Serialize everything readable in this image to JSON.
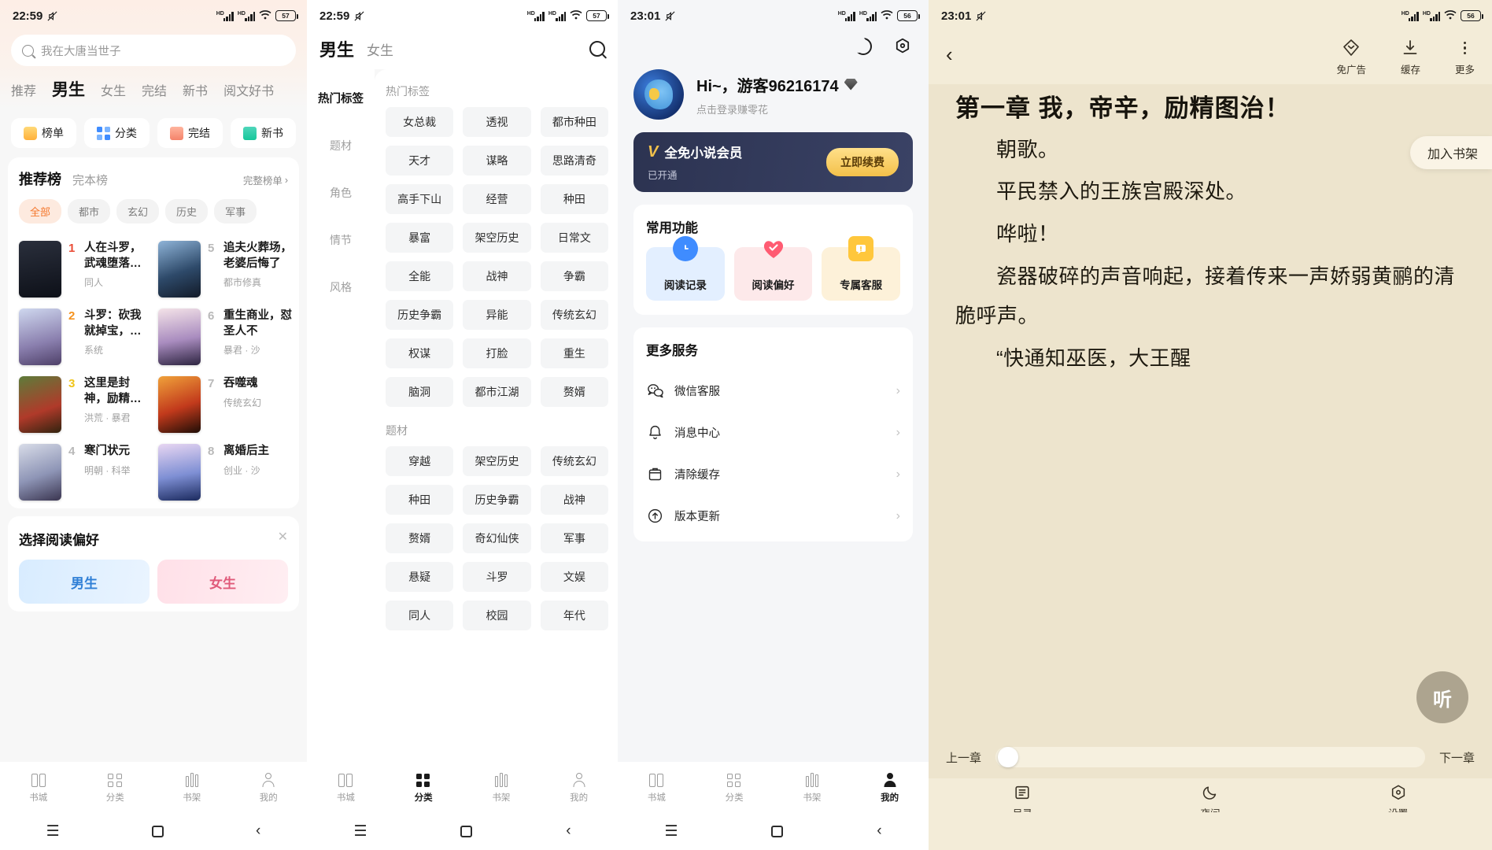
{
  "panel1": {
    "status": {
      "time": "22:59",
      "battery": "57"
    },
    "search": {
      "placeholder": "我在大唐当世子",
      "icon": "search-icon"
    },
    "tabs": [
      {
        "label": "推荐",
        "active": false
      },
      {
        "label": "男生",
        "active": true
      },
      {
        "label": "女生",
        "active": false
      },
      {
        "label": "完结",
        "active": false
      },
      {
        "label": "新书",
        "active": false
      },
      {
        "label": "阅文好书",
        "active": false
      }
    ],
    "quick": [
      {
        "label": "榜单",
        "icon": "rank-icon"
      },
      {
        "label": "分类",
        "icon": "category-icon"
      },
      {
        "label": "完结",
        "icon": "completed-icon"
      },
      {
        "label": "新书",
        "icon": "newbook-icon"
      }
    ],
    "rank": {
      "title": "推荐榜",
      "arrow": "↑",
      "subtab": "完本榜",
      "more": "完整榜单",
      "more_chevron": "›",
      "chips": [
        {
          "label": "全部",
          "active": true
        },
        {
          "label": "都市",
          "active": false
        },
        {
          "label": "玄幻",
          "active": false
        },
        {
          "label": "历史",
          "active": false
        },
        {
          "label": "军事",
          "active": false
        }
      ],
      "left_books": [
        {
          "num": "1",
          "title": "人在斗罗，武魂堕落天使",
          "meta": "同人"
        },
        {
          "num": "2",
          "title": "斗罗：砍我就掉宝，比比东上瘾了",
          "meta": "系统"
        },
        {
          "num": "3",
          "title": "这里是封神，励精图治有什么用",
          "meta": "洪荒 · 暴君"
        },
        {
          "num": "4",
          "title": "寒门状元",
          "meta": "明朝 · 科举"
        }
      ],
      "right_books": [
        {
          "num": "5",
          "title": "追夫火葬场，老婆后悔了",
          "meta": "都市修真"
        },
        {
          "num": "6",
          "title": "重生商业，怼圣人不",
          "meta": "暴君 · 沙"
        },
        {
          "num": "7",
          "title": "吞噬魂",
          "meta": "传统玄幻"
        },
        {
          "num": "8",
          "title": "离婚后主",
          "meta": "创业 · 沙"
        }
      ]
    },
    "pref": {
      "title": "选择阅读偏好",
      "close": "✕",
      "options": [
        {
          "label": "男生"
        },
        {
          "label": "女生"
        }
      ]
    },
    "nav": [
      {
        "label": "书城",
        "active": false,
        "icon": "bookstore-icon"
      },
      {
        "label": "分类",
        "active": false,
        "icon": "category-icon"
      },
      {
        "label": "书架",
        "active": false,
        "icon": "bookshelf-icon"
      },
      {
        "label": "我的",
        "active": false,
        "icon": "profile-icon"
      }
    ]
  },
  "panel2": {
    "status": {
      "time": "22:59",
      "battery": "57"
    },
    "header": {
      "male": "男生",
      "female": "女生",
      "search_icon": "search-icon"
    },
    "side": [
      {
        "label": "热门标签",
        "active": true
      },
      {
        "label": "题材",
        "active": false
      },
      {
        "label": "角色",
        "active": false
      },
      {
        "label": "情节",
        "active": false
      },
      {
        "label": "风格",
        "active": false
      }
    ],
    "sections": [
      {
        "title": "热门标签",
        "tags": [
          "女总裁",
          "透视",
          "都市种田",
          "天才",
          "谋略",
          "思路清奇",
          "高手下山",
          "经营",
          "种田",
          "暴富",
          "架空历史",
          "日常文",
          "全能",
          "战神",
          "争霸",
          "历史争霸",
          "异能",
          "传统玄幻",
          "权谋",
          "打脸",
          "重生",
          "脑洞",
          "都市江湖",
          "赘婿"
        ]
      },
      {
        "title": "题材",
        "tags": [
          "穿越",
          "架空历史",
          "传统玄幻",
          "种田",
          "历史争霸",
          "战神",
          "赘婿",
          "奇幻仙侠",
          "军事",
          "悬疑",
          "斗罗",
          "文娱",
          "同人",
          "校园",
          "年代"
        ]
      }
    ],
    "nav": [
      {
        "label": "书城",
        "active": false,
        "icon": "bookstore-icon"
      },
      {
        "label": "分类",
        "active": true,
        "icon": "category-icon"
      },
      {
        "label": "书架",
        "active": false,
        "icon": "bookshelf-icon"
      },
      {
        "label": "我的",
        "active": false,
        "icon": "profile-icon"
      }
    ]
  },
  "panel3": {
    "status": {
      "time": "23:01",
      "battery": "56"
    },
    "topbar": [
      {
        "icon": "moon-icon"
      },
      {
        "icon": "settings-icon"
      }
    ],
    "user": {
      "greeting": "Hi~，游客96216174",
      "badge": "vip-diamond-icon",
      "sub": "点击登录赚零花",
      "avatar": "eagle-avatar"
    },
    "vip": {
      "logo": "V",
      "title": "全免小说会员",
      "status": "已开通",
      "button": "立即续费"
    },
    "common": {
      "title": "常用功能",
      "items": [
        {
          "label": "阅读记录",
          "icon": "clock-icon",
          "color": "blue"
        },
        {
          "label": "阅读偏好",
          "icon": "heart-icon",
          "color": "red"
        },
        {
          "label": "专属客服",
          "icon": "chat-icon",
          "color": "yellow"
        }
      ]
    },
    "services": {
      "title": "更多服务",
      "items": [
        {
          "label": "微信客服",
          "icon": "wechat-icon",
          "chevron": "›"
        },
        {
          "label": "消息中心",
          "icon": "bell-icon",
          "chevron": "›"
        },
        {
          "label": "清除缓存",
          "icon": "trash-icon",
          "chevron": "›"
        },
        {
          "label": "版本更新",
          "icon": "upload-icon",
          "chevron": "›"
        }
      ]
    },
    "nav": [
      {
        "label": "书城",
        "active": false,
        "icon": "bookstore-icon"
      },
      {
        "label": "分类",
        "active": false,
        "icon": "category-icon"
      },
      {
        "label": "书架",
        "active": false,
        "icon": "bookshelf-icon"
      },
      {
        "label": "我的",
        "active": true,
        "icon": "profile-icon"
      }
    ]
  },
  "panel4": {
    "status": {
      "time": "23:01",
      "battery": "56"
    },
    "back_icon": "back-chevron-icon",
    "actions": [
      {
        "label": "免广告",
        "icon": "no-ads-icon"
      },
      {
        "label": "缓存",
        "icon": "download-icon"
      },
      {
        "label": "更多",
        "icon": "more-dots-icon"
      }
    ],
    "bookshelf_tip": "加入书架",
    "chapter_title": "第一章 我，帝辛，励精图治！",
    "paragraphs": [
      "朝歌。",
      "平民禁入的王族宫殿深处。",
      "哗啦！",
      "瓷器破碎的声音响起，接着传来一声娇弱黄鹂的清脆呼声。",
      "“快通知巫医，大王醒"
    ],
    "listen_button": "听",
    "progress": {
      "prev": "上一章",
      "next": "下一章"
    },
    "tools": [
      {
        "label": "目录",
        "icon": "toc-icon"
      },
      {
        "label": "夜间",
        "icon": "moon-icon"
      },
      {
        "label": "设置",
        "icon": "settings-icon"
      }
    ]
  },
  "sysnav": {
    "menu": "☰",
    "home": "home-square-icon",
    "back": "‹"
  }
}
